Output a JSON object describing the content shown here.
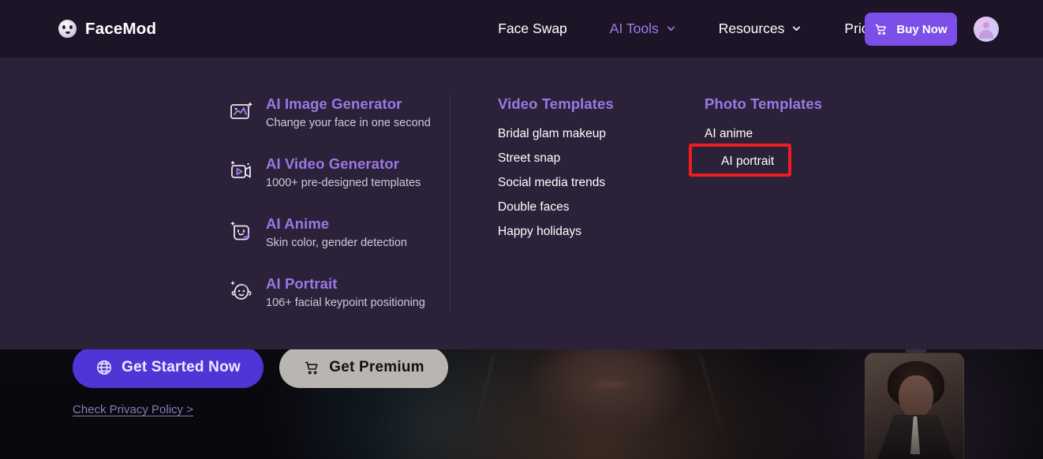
{
  "header": {
    "logo_text": "FaceMod",
    "logo_icon": "face-circle-icon",
    "nav": [
      {
        "label": "Face Swap",
        "active": false,
        "has_chevron": false
      },
      {
        "label": "AI Tools",
        "active": true,
        "has_chevron": true
      },
      {
        "label": "Resources",
        "active": false,
        "has_chevron": true
      },
      {
        "label": "Pricing",
        "active": false,
        "has_chevron": false
      }
    ],
    "buy_button": {
      "label": "Buy Now",
      "icon": "shopping-cart-icon",
      "color": "#7b4fe8"
    },
    "avatar": {
      "icon": "user-avatar-icon"
    },
    "background_color": "#1d1428"
  },
  "dropdown": {
    "background_color": "#2b2138",
    "tools": [
      {
        "title": "AI Image Generator",
        "desc": "Change your face in one second",
        "icon": "image-sparkle-icon"
      },
      {
        "title": "AI Video Generator",
        "desc": "1000+ pre-designed templates",
        "icon": "video-sparkle-icon"
      },
      {
        "title": "AI Anime",
        "desc": "Skin color, gender detection",
        "icon": "anime-face-icon"
      },
      {
        "title": "AI Portrait",
        "desc": "106+ facial keypoint positioning",
        "icon": "portrait-face-icon"
      }
    ],
    "video_templates": {
      "heading": "Video Templates",
      "items": [
        "Bridal glam makeup",
        "Street snap",
        "Social media trends",
        "Double faces",
        "Happy holidays"
      ]
    },
    "photo_templates": {
      "heading": "Photo Templates",
      "items": [
        "AI anime",
        "AI portrait"
      ]
    },
    "highlight": {
      "target": "AI portrait",
      "color": "#ee1c23"
    },
    "accent_color": "#9b78e6"
  },
  "page": {
    "cta_primary": {
      "label": "Get Started Now",
      "icon": "globe-icon",
      "color": "#4f35d6"
    },
    "cta_secondary": {
      "label": "Get Premium",
      "icon": "shopping-cart-icon",
      "color": "#b9b5b1"
    },
    "privacy_link": "Check Privacy Policy >"
  }
}
